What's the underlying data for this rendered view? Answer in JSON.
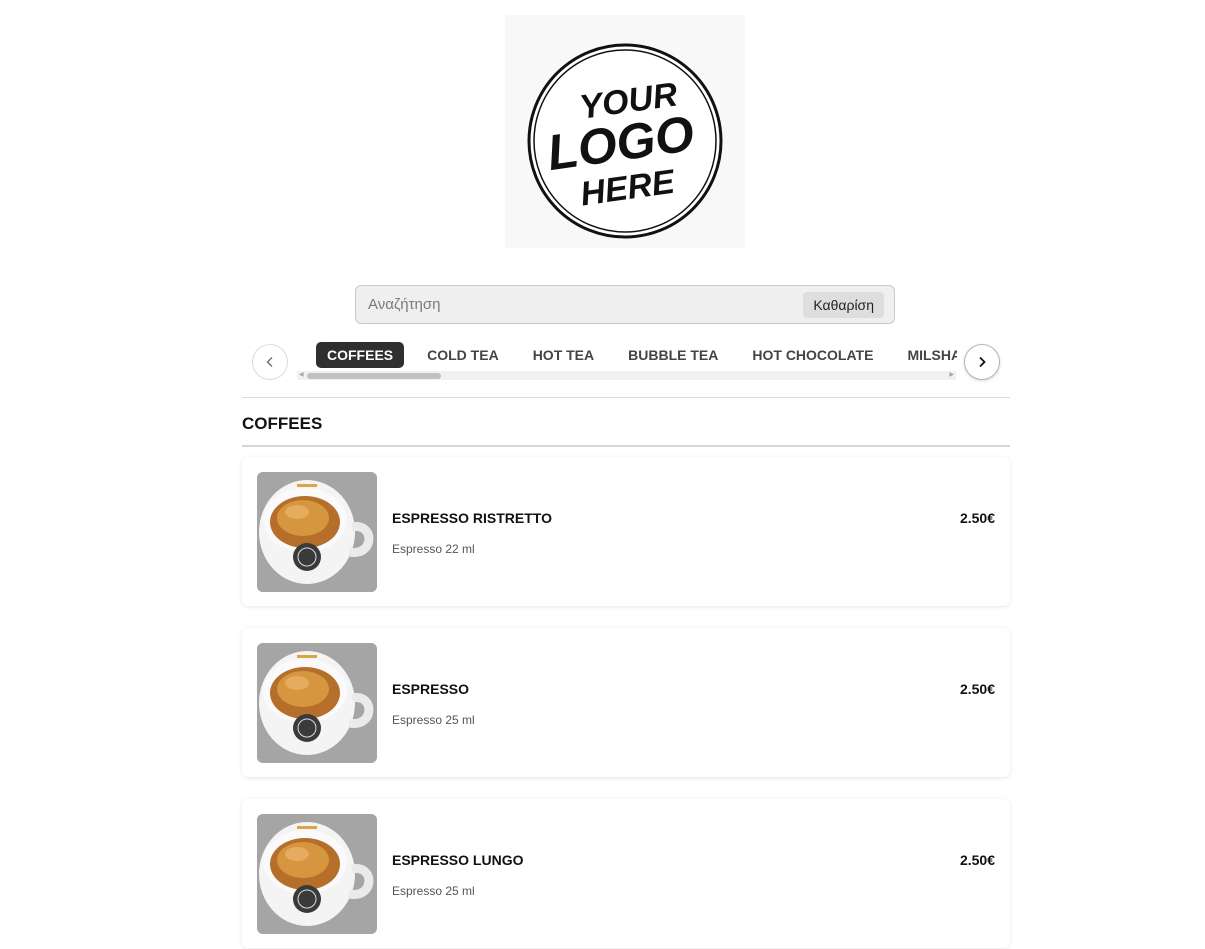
{
  "logo": {
    "alt": "Your Logo Here",
    "lines": [
      "YOUR",
      "LOGO",
      "HERE"
    ]
  },
  "search": {
    "placeholder": "Αναζήτηση",
    "value": "",
    "clear_label": "Καθαρίση"
  },
  "categories": {
    "prev_icon": "chevron-left-icon",
    "next_icon": "chevron-right-icon",
    "items": [
      {
        "label": "COFFEES",
        "active": true
      },
      {
        "label": "COLD TEA",
        "active": false
      },
      {
        "label": "HOT TEA",
        "active": false
      },
      {
        "label": "BUBBLE TEA",
        "active": false
      },
      {
        "label": "HOT CHOCOLATE",
        "active": false
      },
      {
        "label": "MILSHAKE",
        "active": false
      }
    ]
  },
  "section": {
    "title": "COFFEES"
  },
  "products": [
    {
      "name": "ESPRESSO RISTRETTO",
      "description": "Espresso 22 ml",
      "price": "2.50€",
      "image": "espresso-cup-photo"
    },
    {
      "name": "ESPRESSO",
      "description": "Espresso 25 ml",
      "price": "2.50€",
      "image": "espresso-cup-photo"
    },
    {
      "name": "ESPRESSO LUNGO",
      "description": "Espresso 25 ml",
      "price": "2.50€",
      "image": "espresso-cup-photo"
    }
  ],
  "colors": {
    "active_tab_bg": "#2f2f2f",
    "search_bg": "#efefef",
    "accent_coffee": "#c9822f"
  }
}
